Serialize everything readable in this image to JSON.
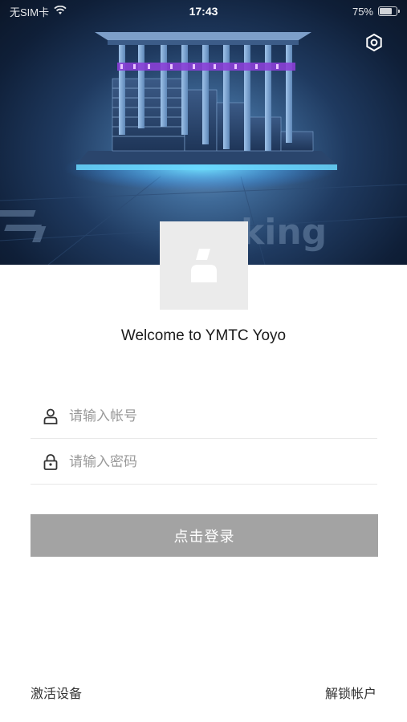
{
  "status_bar": {
    "carrier": "无SIM卡",
    "time": "17:43",
    "battery_percent_text": "75%",
    "battery_level": 0.75
  },
  "hero": {
    "brand_watermark": "king"
  },
  "welcome_text": "Welcome to YMTC Yoyo",
  "form": {
    "account_placeholder": "请输入帐号",
    "password_placeholder": "请输入密码",
    "login_label": "点击登录"
  },
  "footer": {
    "activate_device": "激活设备",
    "unlock_account": "解锁帐户"
  },
  "colors": {
    "login_button_bg": "#a3a3a3",
    "avatar_bg": "#ebebeb",
    "divider": "#e8e8e8"
  },
  "icons": {
    "account": "user-icon",
    "password": "lock-icon",
    "settings": "settings-icon",
    "avatar": "avatar-placeholder-icon"
  }
}
